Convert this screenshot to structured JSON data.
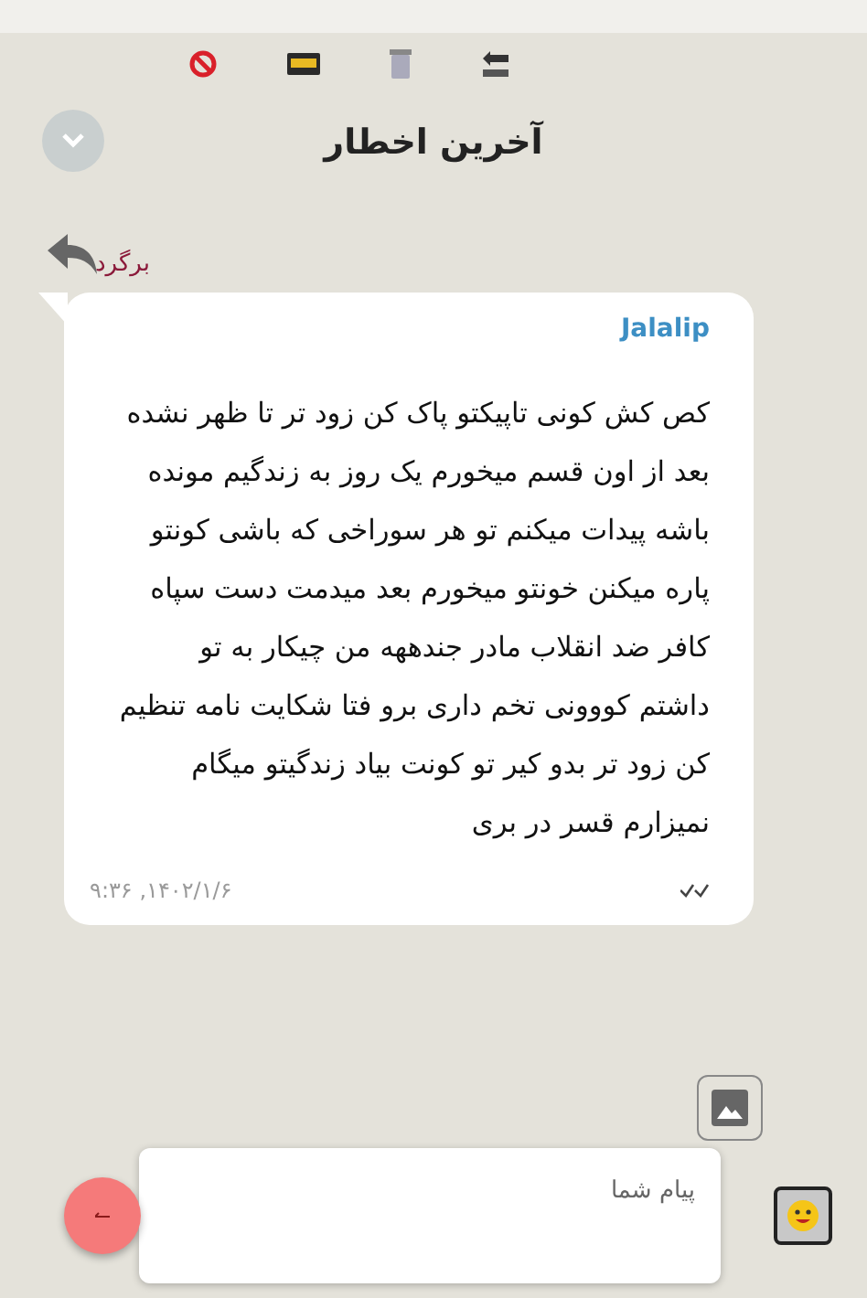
{
  "title": "آخرین اخطار",
  "back_link": "برگرد",
  "message": {
    "sender": "Jalalip",
    "lines": [
      "کص کش کونی تاپیکتو پاک کن زود تر تا ظهر نشده",
      "بعد از اون قسم میخورم یک روز به زندگیم مونده",
      "باشه پیدات میکنم تو هر سوراخی که باشی کونتو",
      "پاره میکنن خونتو میخورم بعد میدمت دست سپاه",
      "کافر ضد انقلاب مادر جندههه من چیکار به تو",
      "داشتم کووونی تخم داری برو فتا شکایت نامه تنظیم",
      "کن زود تر بدو کیر تو کونت بیاد زندگیتو میگام",
      "نمیزارم قسر در بری"
    ],
    "time": "۹:۳۶ ,۱۴۰۲/۱/۶"
  },
  "composer": {
    "placeholder": "پیام شما"
  }
}
